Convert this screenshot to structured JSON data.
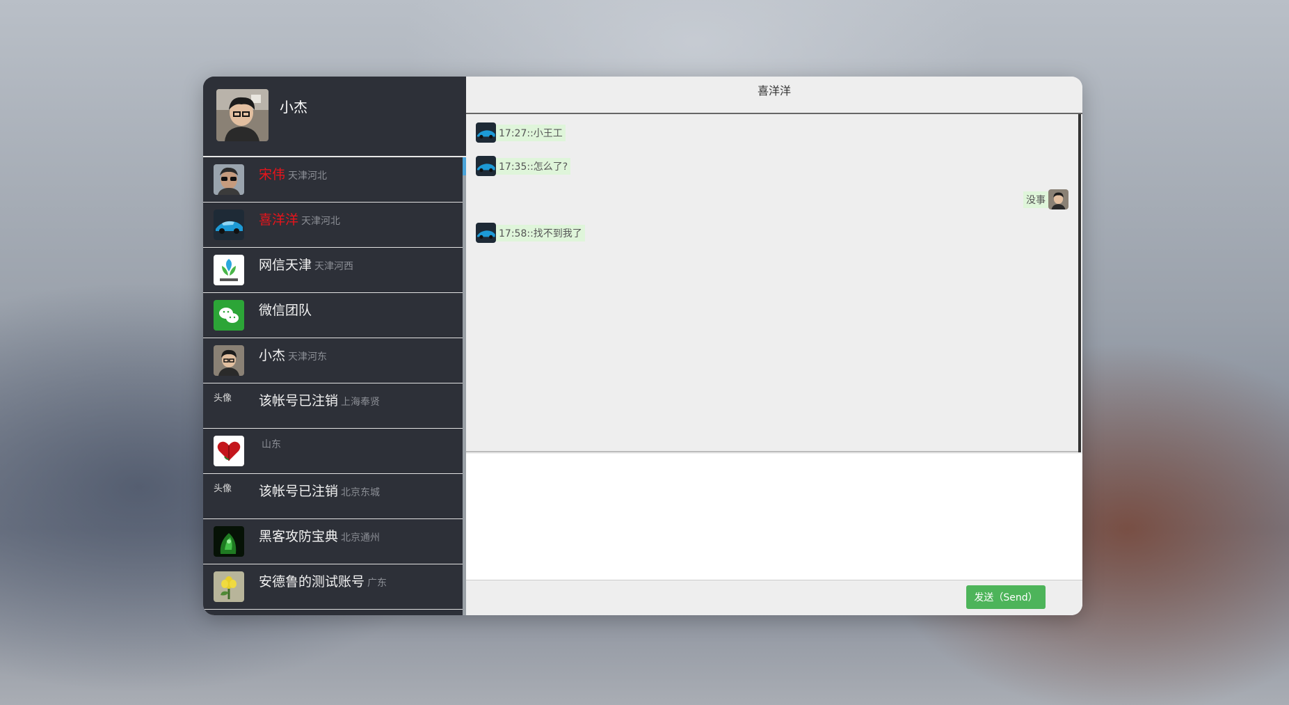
{
  "profile": {
    "name": "小杰",
    "avatar": "person-glasses-avatar"
  },
  "contacts": [
    {
      "name": "宋伟",
      "location": "天津河北",
      "unread": true,
      "avatar": "man-sunglasses-avatar"
    },
    {
      "name": "喜洋洋",
      "location": "天津河北",
      "unread": true,
      "avatar": "blue-car-avatar"
    },
    {
      "name": "网信天津",
      "location": "天津河西",
      "unread": false,
      "avatar": "wangxin-logo-avatar"
    },
    {
      "name": "微信团队",
      "location": "",
      "unread": false,
      "avatar": "wechat-logo-avatar"
    },
    {
      "name": "小杰",
      "location": "天津河东",
      "unread": false,
      "avatar": "person-glasses-avatar"
    },
    {
      "name": "该帐号已注销",
      "location": "上海奉贤",
      "unread": false,
      "avatar": "broken-image",
      "alt": "头像"
    },
    {
      "name": "",
      "location": "山东",
      "unread": false,
      "avatar": "red-heart-avatar"
    },
    {
      "name": "该帐号已注销",
      "location": "北京东城",
      "unread": false,
      "avatar": "broken-image",
      "alt": "头像"
    },
    {
      "name": "黑客攻防宝典",
      "location": "北京通州",
      "unread": false,
      "avatar": "green-hacker-avatar"
    },
    {
      "name": "安德鲁的测试账号",
      "location": "广东",
      "unread": false,
      "avatar": "yellow-flower-avatar"
    }
  ],
  "chat": {
    "title": "喜洋洋",
    "messages": [
      {
        "direction": "in",
        "text": "17:27::小王工",
        "avatar": "blue-car-avatar"
      },
      {
        "direction": "in",
        "text": "17:35::怎么了?",
        "avatar": "blue-car-avatar"
      },
      {
        "direction": "out",
        "text": "没事",
        "avatar": "person-glasses-avatar"
      },
      {
        "direction": "in",
        "text": "17:58::找不到我了",
        "avatar": "blue-car-avatar"
      }
    ],
    "composer_value": "",
    "send_label": "发送（Send）"
  },
  "colors": {
    "sidebar_bg": "#2d3038",
    "unread_name": "#e8141b",
    "bubble_bg": "#dff5da",
    "send_button": "#4db45a",
    "scroll_accent": "#4aa3d8"
  }
}
